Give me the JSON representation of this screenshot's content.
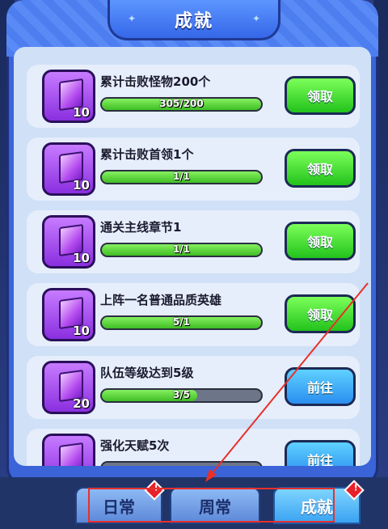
{
  "header": {
    "title": "成就"
  },
  "tasks": [
    {
      "name": "累计击败怪物200个",
      "reward_count": "10",
      "progress_text": "305/200",
      "progress": 1.0,
      "button": "领取",
      "button_style": "green"
    },
    {
      "name": "累计击败首领1个",
      "reward_count": "10",
      "progress_text": "1/1",
      "progress": 1.0,
      "button": "领取",
      "button_style": "green"
    },
    {
      "name": "通关主线章节1",
      "reward_count": "10",
      "progress_text": "1/1",
      "progress": 1.0,
      "button": "领取",
      "button_style": "green"
    },
    {
      "name": "上阵一名普通品质英雄",
      "reward_count": "10",
      "progress_text": "5/1",
      "progress": 1.0,
      "button": "领取",
      "button_style": "green"
    },
    {
      "name": "队伍等级达到5级",
      "reward_count": "20",
      "progress_text": "3/5",
      "progress": 0.6,
      "button": "前往",
      "button_style": "blue"
    },
    {
      "name": "强化天赋5次",
      "reward_count": "",
      "progress_text": "",
      "progress": 0.0,
      "button": "前往",
      "button_style": "blue"
    }
  ],
  "tabs": [
    {
      "label": "日常",
      "active": false
    },
    {
      "label": "周常",
      "active": false
    },
    {
      "label": "成就",
      "active": true
    }
  ],
  "colors": {
    "accent": "#3a64d8",
    "claim": "#23c21c",
    "go": "#2a8ef0",
    "annotation": "#e8302a"
  }
}
